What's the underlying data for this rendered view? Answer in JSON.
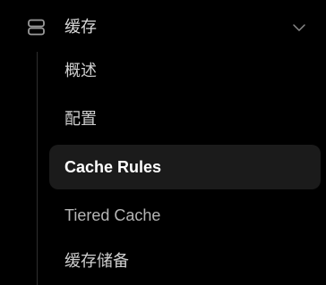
{
  "nav": {
    "group": {
      "icon": "storage-stack-icon",
      "label": "缓存",
      "expand_icon": "chevron-down-icon",
      "expanded": true
    },
    "items": [
      {
        "label": "概述",
        "active": false
      },
      {
        "label": "配置",
        "active": false
      },
      {
        "label": "Cache Rules",
        "active": true
      },
      {
        "label": "Tiered Cache",
        "active": false
      },
      {
        "label": "缓存储备",
        "active": false
      }
    ]
  },
  "colors": {
    "background": "#000000",
    "active_item_bg": "#1b1b1b",
    "text": "#cfcfcf",
    "active_text": "#ffffff",
    "tree_line": "#2e2e2e"
  }
}
